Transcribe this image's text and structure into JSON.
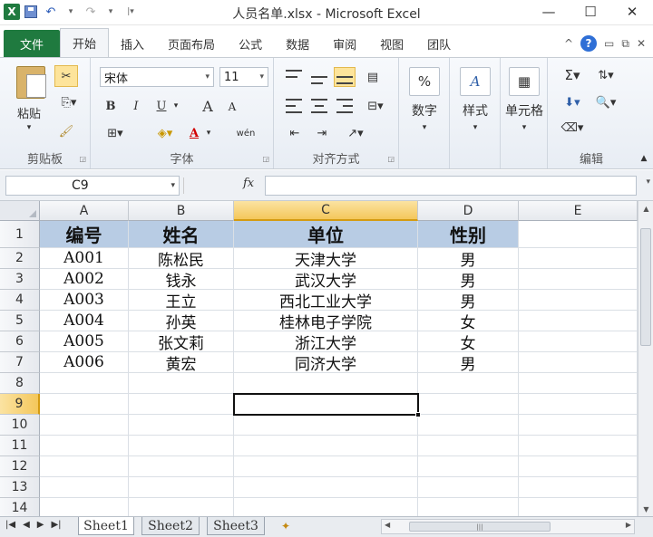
{
  "window": {
    "title": "人员名单.xlsx  -  Microsoft Excel",
    "app_icon_letter": "X",
    "minimize": "—",
    "maximize": "☐",
    "close": "✕"
  },
  "tabs": [
    {
      "label": "文件"
    },
    {
      "label": "开始"
    },
    {
      "label": "插入"
    },
    {
      "label": "页面布局"
    },
    {
      "label": "公式"
    },
    {
      "label": "数据"
    },
    {
      "label": "审阅"
    },
    {
      "label": "视图"
    },
    {
      "label": "团队"
    }
  ],
  "ribbon": {
    "clipboard": {
      "label": "剪贴板",
      "paste": "粘贴"
    },
    "font": {
      "label": "字体",
      "font_name": "宋体",
      "font_size": "11",
      "bold": "B",
      "italic": "I",
      "underline": "U",
      "grow": "A",
      "shrink": "A",
      "color_letter": "A",
      "phonetic": "wén"
    },
    "alignment": {
      "label": "对齐方式"
    },
    "number": {
      "label": "数字",
      "symbol": "%"
    },
    "styles": {
      "label": "样式"
    },
    "cells": {
      "label": "单元格"
    },
    "editing": {
      "label": "编辑",
      "sum": "Σ"
    }
  },
  "formula_bar": {
    "name_box": "C9",
    "fx": "fx",
    "value": ""
  },
  "columns": [
    "A",
    "B",
    "C",
    "D",
    "E"
  ],
  "rows": [
    "1",
    "2",
    "3",
    "4",
    "5",
    "6",
    "7",
    "8",
    "9",
    "10",
    "11",
    "12",
    "13",
    "14"
  ],
  "table": {
    "headers": [
      "编号",
      "姓名",
      "单位",
      "性别"
    ],
    "rows": [
      [
        "A001",
        "陈松民",
        "天津大学",
        "男"
      ],
      [
        "A002",
        "钱永",
        "武汉大学",
        "男"
      ],
      [
        "A003",
        "王立",
        "西北工业大学",
        "男"
      ],
      [
        "A004",
        "孙英",
        "桂林电子学院",
        "女"
      ],
      [
        "A005",
        "张文莉",
        "浙江大学",
        "女"
      ],
      [
        "A006",
        "黄宏",
        "同济大学",
        "男"
      ]
    ]
  },
  "selection": {
    "column": "C",
    "row": "9"
  },
  "sheets": [
    {
      "name": "Sheet1",
      "active": true
    },
    {
      "name": "Sheet2",
      "active": false
    },
    {
      "name": "Sheet3",
      "active": false
    }
  ],
  "colors": {
    "file_tab": "#1f7a3f",
    "header_fill": "#b8cce4",
    "selection_header": "#f4c75b"
  }
}
